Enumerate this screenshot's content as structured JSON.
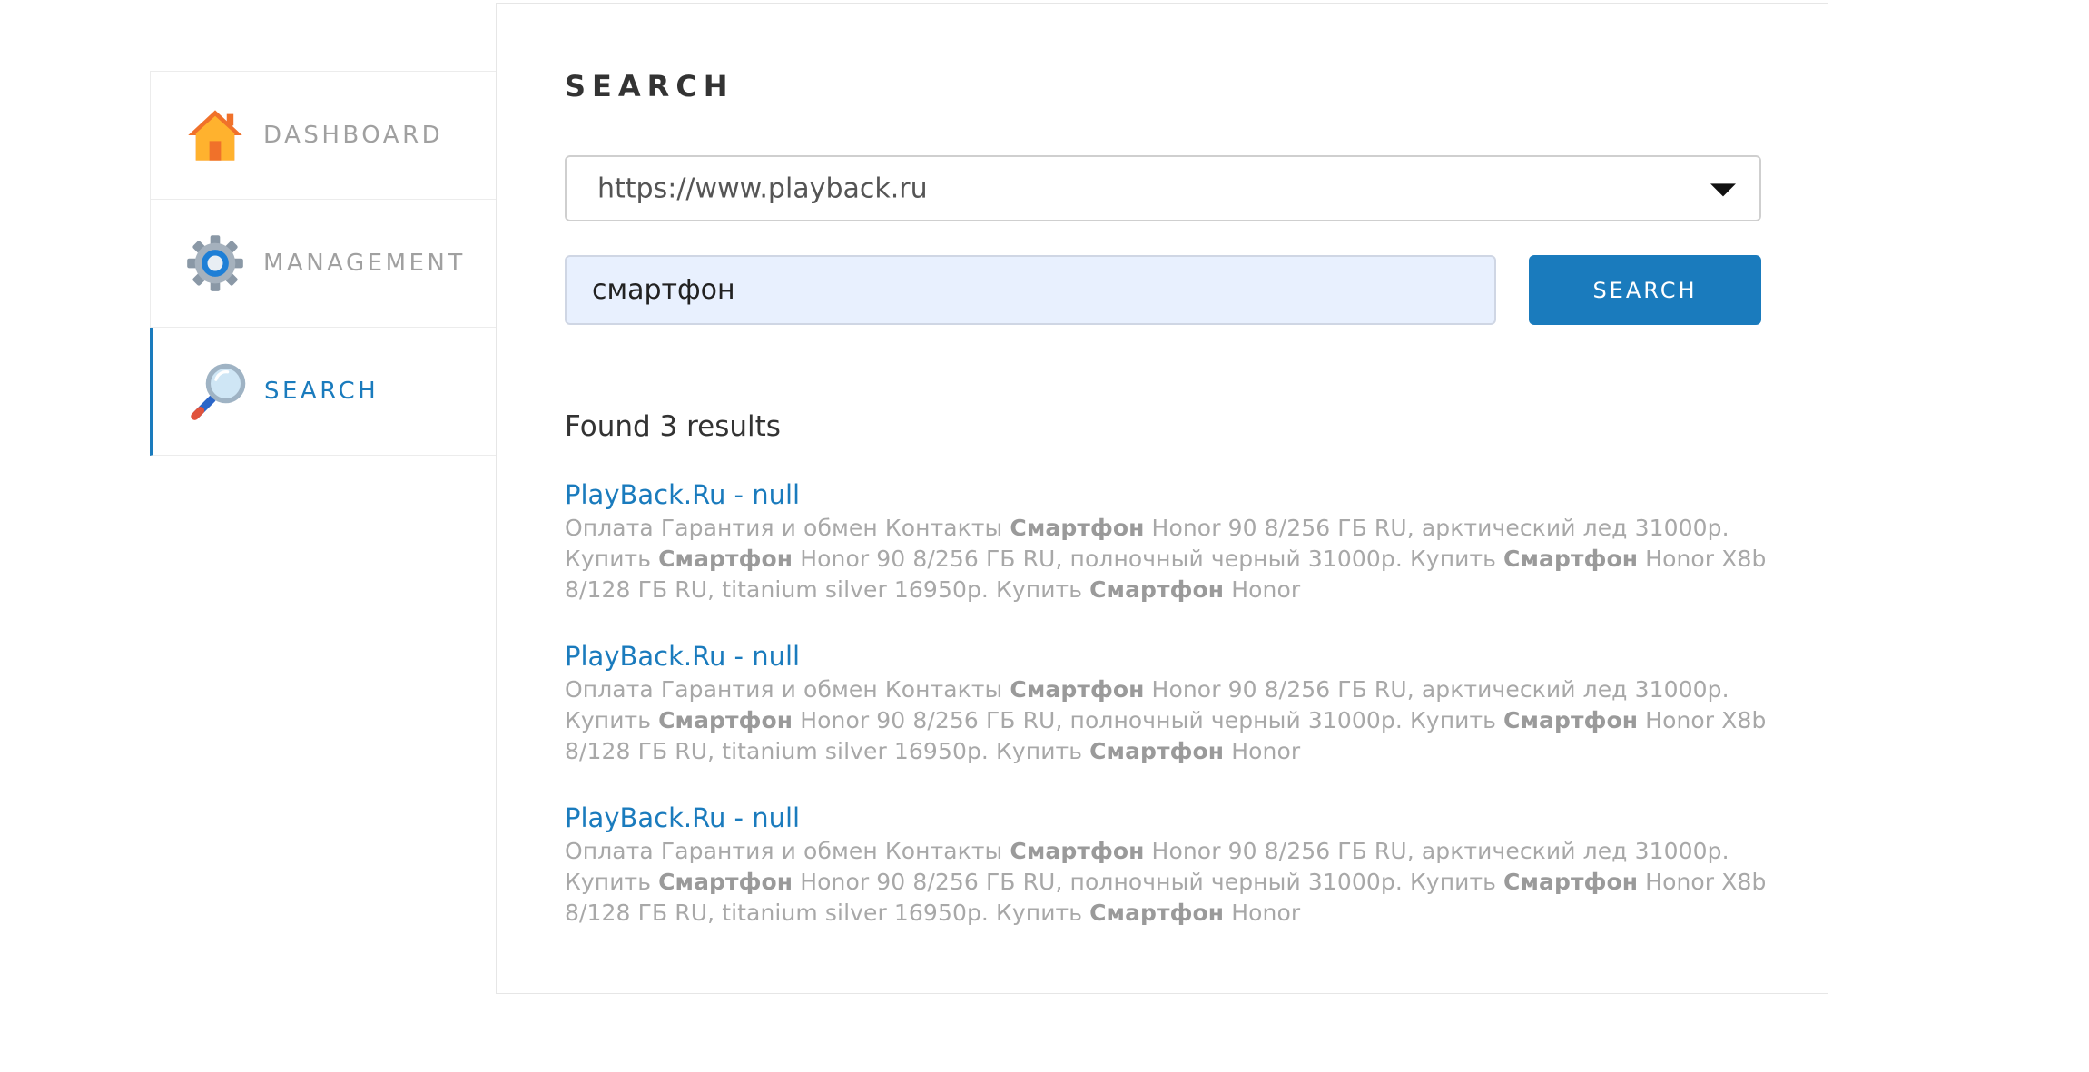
{
  "sidebar": {
    "items": [
      {
        "label": "DASHBOARD",
        "icon": "home-icon",
        "active": false
      },
      {
        "label": "MANAGEMENT",
        "icon": "gear-icon",
        "active": false
      },
      {
        "label": "SEARCH",
        "icon": "magnifier-icon",
        "active": true
      }
    ]
  },
  "main": {
    "title": "SEARCH",
    "site_select": {
      "value": "https://www.playback.ru"
    },
    "query_input": {
      "value": "смартфон"
    },
    "search_button": "SEARCH",
    "results_count": "Found 3 results",
    "results": [
      {
        "title": "PlayBack.Ru - null",
        "snippet": [
          {
            "t": "Оплата Гарантия и обмен Контакты ",
            "b": false
          },
          {
            "t": "Смартфон",
            "b": true
          },
          {
            "t": " Honor 90 8/256 ГБ RU, арктический лед 31000р. Купить ",
            "b": false
          },
          {
            "t": "Смартфон",
            "b": true
          },
          {
            "t": " Honor 90 8/256 ГБ RU, полночный черный 31000р. Купить ",
            "b": false
          },
          {
            "t": "Смартфон",
            "b": true
          },
          {
            "t": " Honor X8b 8/128 ГБ RU, titanium silver 16950р. Купить ",
            "b": false
          },
          {
            "t": "Смартфон",
            "b": true
          },
          {
            "t": " Honor",
            "b": false
          }
        ]
      },
      {
        "title": "PlayBack.Ru - null",
        "snippet": [
          {
            "t": "Оплата Гарантия и обмен Контакты ",
            "b": false
          },
          {
            "t": "Смартфон",
            "b": true
          },
          {
            "t": " Honor 90 8/256 ГБ RU, арктический лед 31000р. Купить ",
            "b": false
          },
          {
            "t": "Смартфон",
            "b": true
          },
          {
            "t": " Honor 90 8/256 ГБ RU, полночный черный 31000р. Купить ",
            "b": false
          },
          {
            "t": "Смартфон",
            "b": true
          },
          {
            "t": " Honor X8b 8/128 ГБ RU, titanium silver 16950р. Купить ",
            "b": false
          },
          {
            "t": "Смартфон",
            "b": true
          },
          {
            "t": " Honor",
            "b": false
          }
        ]
      },
      {
        "title": "PlayBack.Ru - null",
        "snippet": [
          {
            "t": "Оплата Гарантия и обмен Контакты ",
            "b": false
          },
          {
            "t": "Смартфон",
            "b": true
          },
          {
            "t": " Honor 90 8/256 ГБ RU, арктический лед 31000р. Купить ",
            "b": false
          },
          {
            "t": "Смартфон",
            "b": true
          },
          {
            "t": " Honor 90 8/256 ГБ RU, полночный черный 31000р. Купить ",
            "b": false
          },
          {
            "t": "Смартфон",
            "b": true
          },
          {
            "t": " Honor X8b 8/128 ГБ RU, titanium silver 16950р. Купить ",
            "b": false
          },
          {
            "t": "Смартфон",
            "b": true
          },
          {
            "t": " Honor",
            "b": false
          }
        ]
      }
    ]
  },
  "colors": {
    "accent": "#1a7bbd",
    "muted_text": "#a8a8a8",
    "input_bg": "#e8f0fe"
  }
}
